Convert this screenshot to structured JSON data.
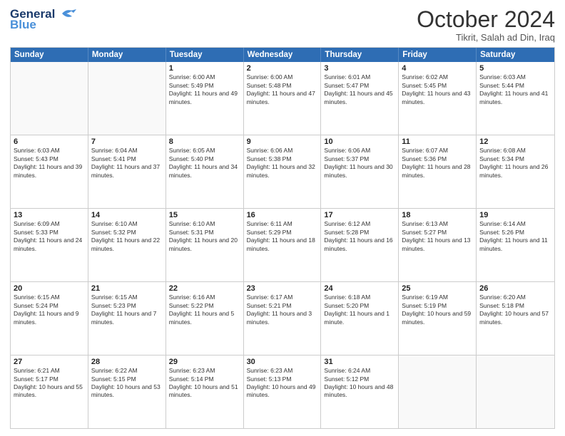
{
  "header": {
    "logo_line1": "General",
    "logo_line2": "Blue",
    "month": "October 2024",
    "location": "Tikrit, Salah ad Din, Iraq"
  },
  "weekdays": [
    "Sunday",
    "Monday",
    "Tuesday",
    "Wednesday",
    "Thursday",
    "Friday",
    "Saturday"
  ],
  "rows": [
    [
      {
        "day": "",
        "info": ""
      },
      {
        "day": "",
        "info": ""
      },
      {
        "day": "1",
        "info": "Sunrise: 6:00 AM\nSunset: 5:49 PM\nDaylight: 11 hours and 49 minutes."
      },
      {
        "day": "2",
        "info": "Sunrise: 6:00 AM\nSunset: 5:48 PM\nDaylight: 11 hours and 47 minutes."
      },
      {
        "day": "3",
        "info": "Sunrise: 6:01 AM\nSunset: 5:47 PM\nDaylight: 11 hours and 45 minutes."
      },
      {
        "day": "4",
        "info": "Sunrise: 6:02 AM\nSunset: 5:45 PM\nDaylight: 11 hours and 43 minutes."
      },
      {
        "day": "5",
        "info": "Sunrise: 6:03 AM\nSunset: 5:44 PM\nDaylight: 11 hours and 41 minutes."
      }
    ],
    [
      {
        "day": "6",
        "info": "Sunrise: 6:03 AM\nSunset: 5:43 PM\nDaylight: 11 hours and 39 minutes."
      },
      {
        "day": "7",
        "info": "Sunrise: 6:04 AM\nSunset: 5:41 PM\nDaylight: 11 hours and 37 minutes."
      },
      {
        "day": "8",
        "info": "Sunrise: 6:05 AM\nSunset: 5:40 PM\nDaylight: 11 hours and 34 minutes."
      },
      {
        "day": "9",
        "info": "Sunrise: 6:06 AM\nSunset: 5:38 PM\nDaylight: 11 hours and 32 minutes."
      },
      {
        "day": "10",
        "info": "Sunrise: 6:06 AM\nSunset: 5:37 PM\nDaylight: 11 hours and 30 minutes."
      },
      {
        "day": "11",
        "info": "Sunrise: 6:07 AM\nSunset: 5:36 PM\nDaylight: 11 hours and 28 minutes."
      },
      {
        "day": "12",
        "info": "Sunrise: 6:08 AM\nSunset: 5:34 PM\nDaylight: 11 hours and 26 minutes."
      }
    ],
    [
      {
        "day": "13",
        "info": "Sunrise: 6:09 AM\nSunset: 5:33 PM\nDaylight: 11 hours and 24 minutes."
      },
      {
        "day": "14",
        "info": "Sunrise: 6:10 AM\nSunset: 5:32 PM\nDaylight: 11 hours and 22 minutes."
      },
      {
        "day": "15",
        "info": "Sunrise: 6:10 AM\nSunset: 5:31 PM\nDaylight: 11 hours and 20 minutes."
      },
      {
        "day": "16",
        "info": "Sunrise: 6:11 AM\nSunset: 5:29 PM\nDaylight: 11 hours and 18 minutes."
      },
      {
        "day": "17",
        "info": "Sunrise: 6:12 AM\nSunset: 5:28 PM\nDaylight: 11 hours and 16 minutes."
      },
      {
        "day": "18",
        "info": "Sunrise: 6:13 AM\nSunset: 5:27 PM\nDaylight: 11 hours and 13 minutes."
      },
      {
        "day": "19",
        "info": "Sunrise: 6:14 AM\nSunset: 5:26 PM\nDaylight: 11 hours and 11 minutes."
      }
    ],
    [
      {
        "day": "20",
        "info": "Sunrise: 6:15 AM\nSunset: 5:24 PM\nDaylight: 11 hours and 9 minutes."
      },
      {
        "day": "21",
        "info": "Sunrise: 6:15 AM\nSunset: 5:23 PM\nDaylight: 11 hours and 7 minutes."
      },
      {
        "day": "22",
        "info": "Sunrise: 6:16 AM\nSunset: 5:22 PM\nDaylight: 11 hours and 5 minutes."
      },
      {
        "day": "23",
        "info": "Sunrise: 6:17 AM\nSunset: 5:21 PM\nDaylight: 11 hours and 3 minutes."
      },
      {
        "day": "24",
        "info": "Sunrise: 6:18 AM\nSunset: 5:20 PM\nDaylight: 11 hours and 1 minute."
      },
      {
        "day": "25",
        "info": "Sunrise: 6:19 AM\nSunset: 5:19 PM\nDaylight: 10 hours and 59 minutes."
      },
      {
        "day": "26",
        "info": "Sunrise: 6:20 AM\nSunset: 5:18 PM\nDaylight: 10 hours and 57 minutes."
      }
    ],
    [
      {
        "day": "27",
        "info": "Sunrise: 6:21 AM\nSunset: 5:17 PM\nDaylight: 10 hours and 55 minutes."
      },
      {
        "day": "28",
        "info": "Sunrise: 6:22 AM\nSunset: 5:15 PM\nDaylight: 10 hours and 53 minutes."
      },
      {
        "day": "29",
        "info": "Sunrise: 6:23 AM\nSunset: 5:14 PM\nDaylight: 10 hours and 51 minutes."
      },
      {
        "day": "30",
        "info": "Sunrise: 6:23 AM\nSunset: 5:13 PM\nDaylight: 10 hours and 49 minutes."
      },
      {
        "day": "31",
        "info": "Sunrise: 6:24 AM\nSunset: 5:12 PM\nDaylight: 10 hours and 48 minutes."
      },
      {
        "day": "",
        "info": ""
      },
      {
        "day": "",
        "info": ""
      }
    ]
  ]
}
